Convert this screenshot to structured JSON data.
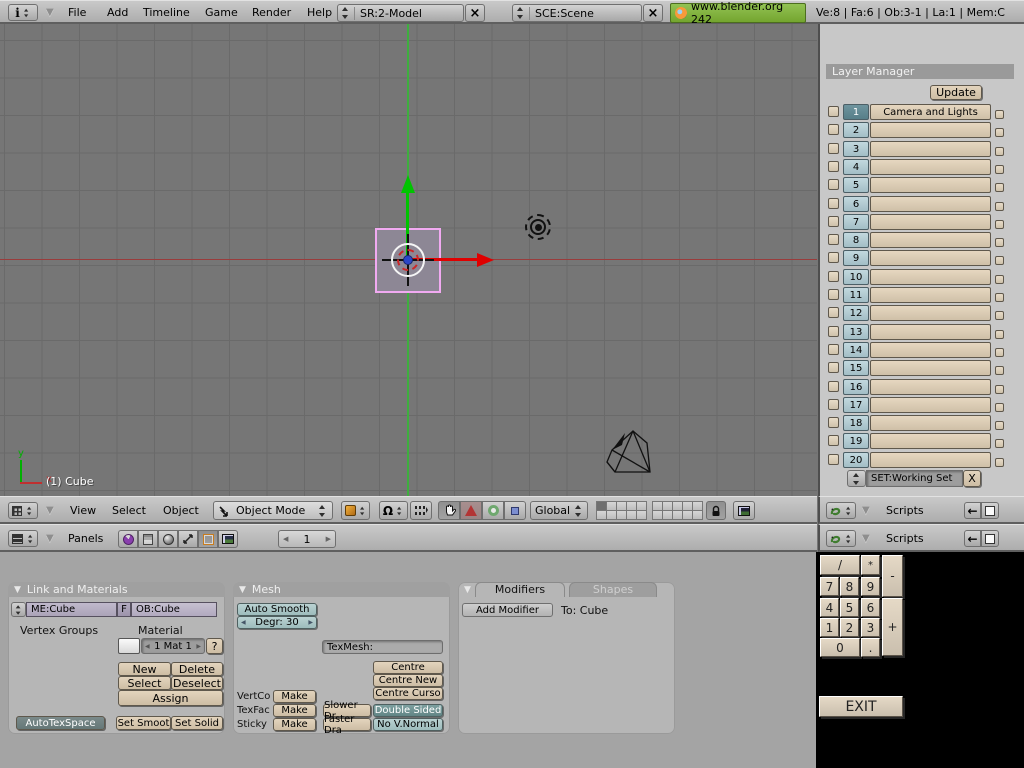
{
  "topbar": {
    "menus": [
      "File",
      "Add",
      "Timeline",
      "Game",
      "Render",
      "Help"
    ],
    "screen_selector": "SR:2-Model",
    "scene_selector": "SCE:Scene",
    "close_x": "×",
    "version_button": "www.blender.org 242",
    "stats": "Ve:8 | Fa:6 | Ob:3-1 | La:1  | Mem:C"
  },
  "viewport": {
    "object_info": "(1) Cube",
    "axis_x_label": "x",
    "axis_y_label": "y"
  },
  "layer_manager": {
    "title": "Layer Manager",
    "update_label": "Update",
    "set_field": "SET:Working Set",
    "set_close": "X",
    "layers": [
      {
        "num": "1",
        "name": "Camera and Lights",
        "selected": true
      },
      {
        "num": "2",
        "name": ""
      },
      {
        "num": "3",
        "name": ""
      },
      {
        "num": "4",
        "name": ""
      },
      {
        "num": "5",
        "name": ""
      },
      {
        "num": "6",
        "name": ""
      },
      {
        "num": "7",
        "name": ""
      },
      {
        "num": "8",
        "name": ""
      },
      {
        "num": "9",
        "name": ""
      },
      {
        "num": "10",
        "name": ""
      },
      {
        "num": "11",
        "name": ""
      },
      {
        "num": "12",
        "name": ""
      },
      {
        "num": "13",
        "name": ""
      },
      {
        "num": "14",
        "name": ""
      },
      {
        "num": "15",
        "name": ""
      },
      {
        "num": "16",
        "name": ""
      },
      {
        "num": "17",
        "name": ""
      },
      {
        "num": "18",
        "name": ""
      },
      {
        "num": "19",
        "name": ""
      },
      {
        "num": "20",
        "name": ""
      }
    ]
  },
  "view3d_header": {
    "menus": [
      "View",
      "Select",
      "Object"
    ],
    "mode": "Object Mode",
    "orientation": "Global"
  },
  "buttons_header": {
    "panels_label": "Panels",
    "frame": "1",
    "prev": "◀",
    "next": "▶"
  },
  "link_materials_panel": {
    "title": "Link and Materials",
    "me_field": "ME:Cube",
    "f_button": "F",
    "ob_field": "OB:Cube",
    "vertex_groups_label": "Vertex Groups",
    "material_label": "Material",
    "mat_index": "1 Mat 1",
    "help_button": "?",
    "new": "New",
    "delete": "Delete",
    "select": "Select",
    "deselect": "Deselect",
    "assign": "Assign",
    "autotexspace": "AutoTexSpace",
    "set_smooth": "Set Smoot",
    "set_solid": "Set Solid"
  },
  "mesh_panel": {
    "title": "Mesh",
    "auto_smooth": "Auto Smooth",
    "degr": "Degr: 30",
    "texmesh": "TexMesh:",
    "centre": "Centre",
    "centre_new": "Centre New",
    "centre_cursor": "Centre Curso",
    "vertcol_label": "VertCo",
    "texfac_label": "TexFac",
    "sticky_label": "Sticky",
    "make": "Make",
    "slower_draw": "Slower Dr",
    "faster_draw": "Faster Dra",
    "double_sided": "Double Sided",
    "no_vnormal": "No V.Normal"
  },
  "modifiers_panel": {
    "tab_modifiers": "Modifiers",
    "tab_shapes": "Shapes",
    "add_modifier": "Add Modifier",
    "target": "To: Cube"
  },
  "scripts_header": {
    "label": "Scripts",
    "back_arrow": "←"
  },
  "calculator": {
    "keys": [
      "/",
      "*",
      "-",
      "7",
      "8",
      "9",
      "4",
      "5",
      "6",
      "1",
      "2",
      "3",
      "+",
      "0",
      "."
    ],
    "exit_label": "EXIT"
  },
  "colors": {
    "header_bg": "#b4b4b4",
    "viewport_bg": "#767676",
    "grid_line": "#6a6a6a",
    "buttons_bg": "#a4a4a4",
    "right_panel_bg": "#c8c8c8",
    "beige_button": "#d8c7b0",
    "teal_button": "#a9c8c8",
    "teal_dark": "#6e9898",
    "selection_pink": "#f1aaf1",
    "axis_red": "#e00000",
    "axis_green": "#00c000",
    "blender_green": "#80b73e"
  }
}
